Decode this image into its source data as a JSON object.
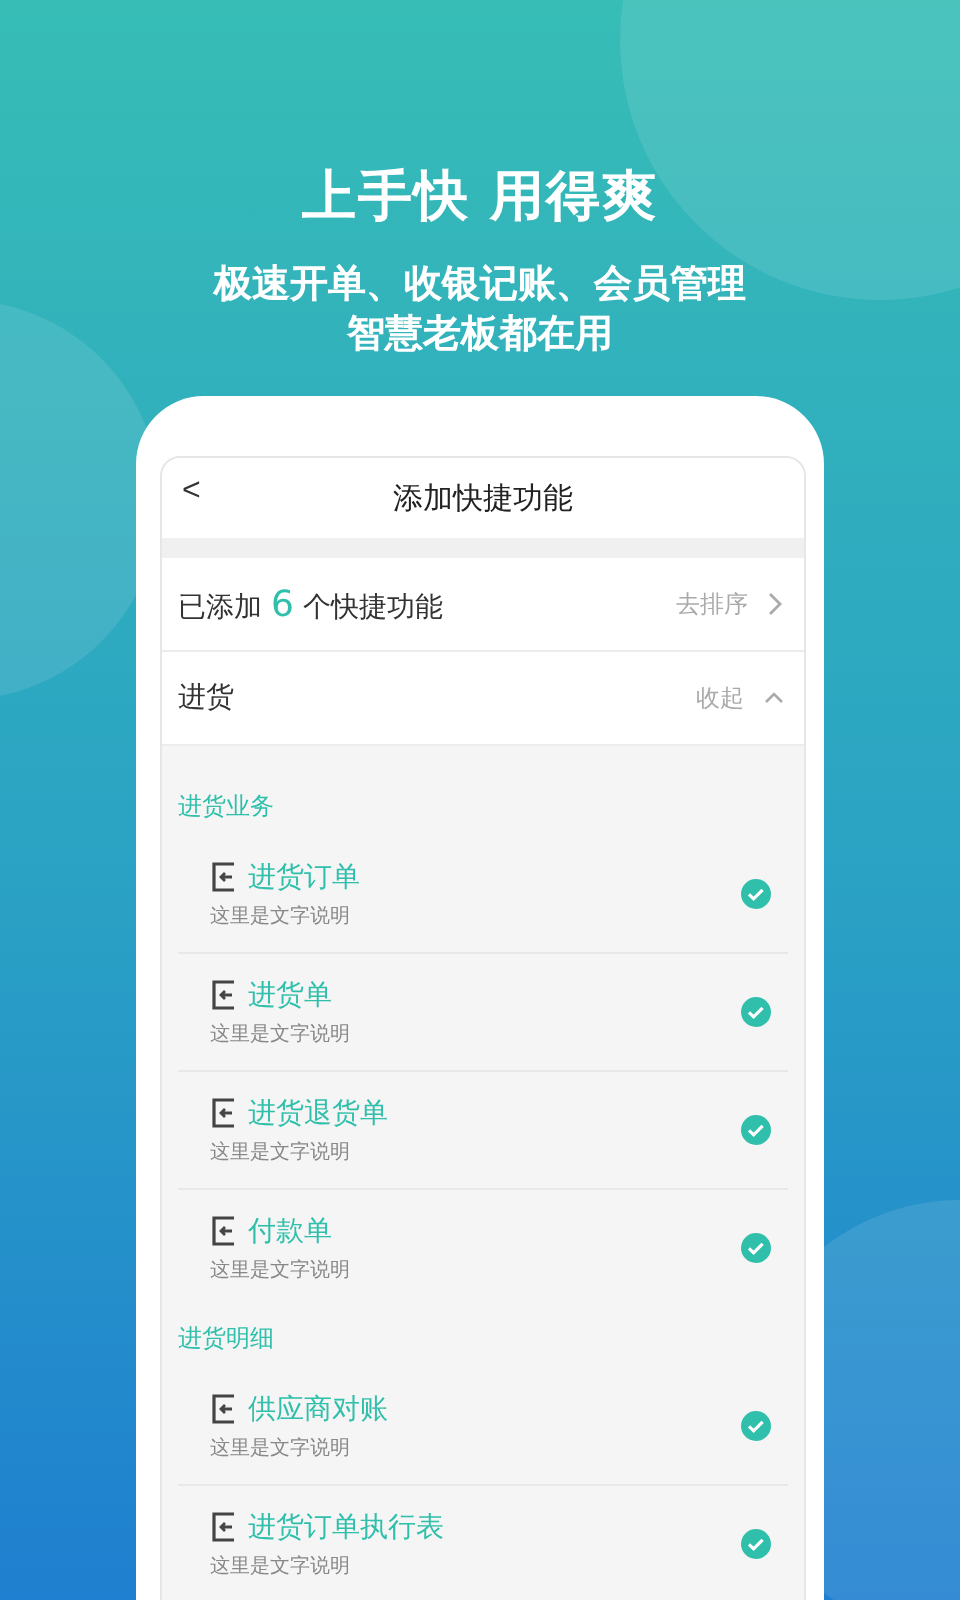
{
  "hero": {
    "title": "上手快 用得爽",
    "subtitle_lines": [
      "极速开单、收银记账、会员管理",
      "智慧老板都在用"
    ]
  },
  "nav": {
    "back": "<",
    "title": "添加快捷功能"
  },
  "added_row": {
    "prefix": "已添加",
    "count": "6",
    "suffix": "个快捷功能",
    "action": "去排序"
  },
  "category": {
    "name": "进货",
    "toggle": "收起",
    "expanded": true
  },
  "groups": [
    {
      "title": "进货业务",
      "items": [
        {
          "title": "进货订单",
          "desc": "这里是文字说明",
          "checked": true
        },
        {
          "title": "进货单",
          "desc": "这里是文字说明",
          "checked": true
        },
        {
          "title": "进货退货单",
          "desc": "这里是文字说明",
          "checked": true
        },
        {
          "title": "付款单",
          "desc": "这里是文字说明",
          "checked": true
        }
      ]
    },
    {
      "title": "进货明细",
      "items": [
        {
          "title": "供应商对账",
          "desc": "这里是文字说明",
          "checked": true
        },
        {
          "title": "进货订单执行表",
          "desc": "这里是文字说明",
          "checked": true
        }
      ]
    }
  ]
}
